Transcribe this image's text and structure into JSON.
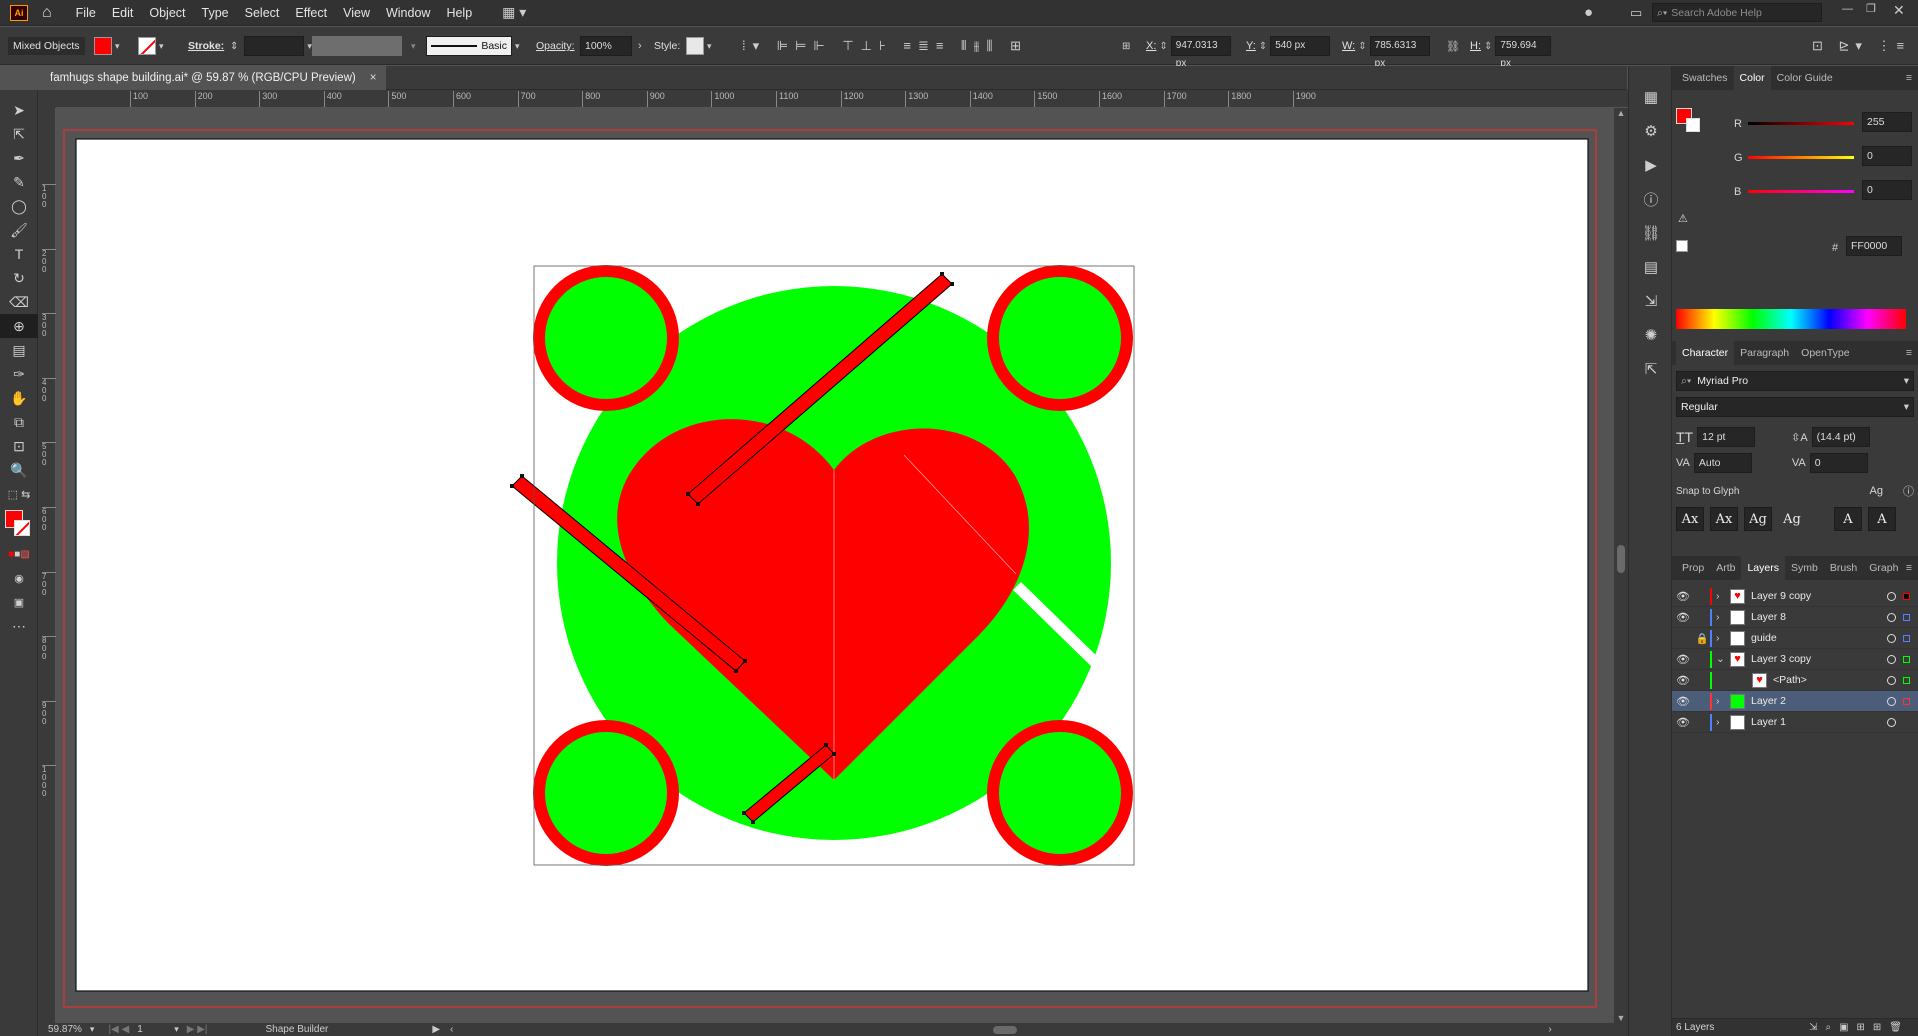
{
  "app": {
    "logo": "Ai",
    "menu": [
      "File",
      "Edit",
      "Object",
      "Type",
      "Select",
      "Effect",
      "View",
      "Window",
      "Help"
    ],
    "search_placeholder": "Search Adobe Help"
  },
  "control_bar": {
    "selection_label": "Mixed Objects",
    "stroke_label": "Stroke:",
    "brush_label": "Basic",
    "opacity_label": "Opacity:",
    "opacity_value": "100%",
    "style_label": "Style:",
    "x_label": "X:",
    "x_value": "947.0313 px",
    "y_label": "Y:",
    "y_value": "540 px",
    "w_label": "W:",
    "w_value": "785.6313 px",
    "h_label": "H:",
    "h_value": "759.694 px",
    "fill_color": "#ff0000"
  },
  "document": {
    "tab_title": "famhugs shape building.ai* @ 59.87 % (RGB/CPU Preview)",
    "close": "×"
  },
  "ruler": {
    "h_ticks": [
      "100",
      "200",
      "300",
      "400",
      "500",
      "600",
      "700",
      "800",
      "900",
      "1000",
      "1100",
      "1200",
      "1300",
      "1400",
      "1500",
      "1600",
      "1700",
      "1800",
      "1900"
    ],
    "v_ticks": [
      "1\n0\n0",
      "2\n0\n0",
      "3\n0\n0",
      "4\n0\n0",
      "5\n0\n0",
      "6\n0\n0",
      "7\n0\n0",
      "8\n0\n0",
      "9\n0\n0",
      "1\n0\n0\n0"
    ]
  },
  "status": {
    "zoom": "59.87%",
    "artboard": "1",
    "tool": "Shape Builder"
  },
  "colors": {
    "green": "#00ff00",
    "red": "#ff0000",
    "white": "#ffffff",
    "selection": "#000000"
  },
  "color_panel": {
    "tabs": [
      "Swatches",
      "Color",
      "Color Guide"
    ],
    "active_tab": "Color",
    "r_label": "R",
    "r_value": "255",
    "g_label": "G",
    "g_value": "0",
    "b_label": "B",
    "b_value": "0",
    "hex_label": "#",
    "hex_value": "FF0000"
  },
  "character_panel": {
    "tabs": [
      "Character",
      "Paragraph",
      "OpenType"
    ],
    "font_family": "Myriad Pro",
    "font_style": "Regular",
    "font_size": "12 pt",
    "leading": "(14.4 pt)",
    "kerning": "Auto",
    "tracking": "0",
    "snap_label": "Snap to Glyph"
  },
  "layers_panel": {
    "tabs": [
      "Prop",
      "Artb",
      "Layers",
      "Symb",
      "Brush",
      "Graph"
    ],
    "active_tab": "Layers",
    "layers": [
      {
        "name": "Layer 9 copy",
        "color": "#ff0000",
        "visible": true,
        "locked": false,
        "expanded": false,
        "child": false,
        "thumb": "heart"
      },
      {
        "name": "Layer 8",
        "color": "#4f80ff",
        "visible": true,
        "locked": false,
        "expanded": false,
        "child": false,
        "thumb": "white"
      },
      {
        "name": "guide",
        "color": "#4f80ff",
        "visible": false,
        "locked": true,
        "expanded": false,
        "child": false,
        "thumb": "white"
      },
      {
        "name": "Layer 3 copy",
        "color": "#00ff00",
        "visible": true,
        "locked": false,
        "expanded": true,
        "child": false,
        "thumb": "heart"
      },
      {
        "name": "<Path>",
        "color": "#00ff00",
        "visible": true,
        "locked": false,
        "expanded": false,
        "child": true,
        "thumb": "heart"
      },
      {
        "name": "Layer 2",
        "color": "#ff3333",
        "visible": true,
        "locked": false,
        "expanded": false,
        "child": false,
        "thumb": "green",
        "selected": true
      },
      {
        "name": "Layer 1",
        "color": "#4f80ff",
        "visible": true,
        "locked": false,
        "expanded": false,
        "child": false,
        "thumb": "white"
      }
    ],
    "count": "6 Layers"
  }
}
